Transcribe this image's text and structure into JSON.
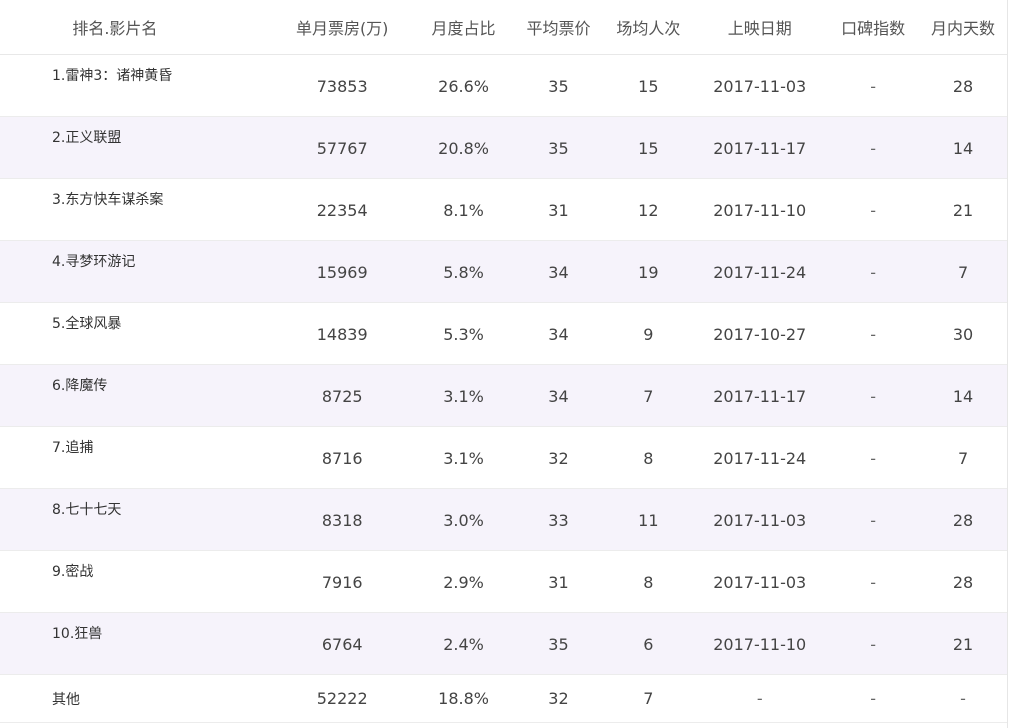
{
  "headers": {
    "name": "排名.影片名",
    "box_office": "单月票房(万)",
    "share": "月度占比",
    "avg_price": "平均票价",
    "avg_attendance": "场均人次",
    "release_date": "上映日期",
    "rating": "口碑指数",
    "days": "月内天数"
  },
  "rows": [
    {
      "name": "1.雷神3：诸神黄昏",
      "box_office": "73853",
      "share": "26.6%",
      "avg_price": "35",
      "avg_attendance": "15",
      "release_date": "2017-11-03",
      "rating": "-",
      "days": "28"
    },
    {
      "name": "2.正义联盟",
      "box_office": "57767",
      "share": "20.8%",
      "avg_price": "35",
      "avg_attendance": "15",
      "release_date": "2017-11-17",
      "rating": "-",
      "days": "14"
    },
    {
      "name": "3.东方快车谋杀案",
      "box_office": "22354",
      "share": "8.1%",
      "avg_price": "31",
      "avg_attendance": "12",
      "release_date": "2017-11-10",
      "rating": "-",
      "days": "21"
    },
    {
      "name": "4.寻梦环游记",
      "box_office": "15969",
      "share": "5.8%",
      "avg_price": "34",
      "avg_attendance": "19",
      "release_date": "2017-11-24",
      "rating": "-",
      "days": "7"
    },
    {
      "name": "5.全球风暴",
      "box_office": "14839",
      "share": "5.3%",
      "avg_price": "34",
      "avg_attendance": "9",
      "release_date": "2017-10-27",
      "rating": "-",
      "days": "30"
    },
    {
      "name": "6.降魔传",
      "box_office": "8725",
      "share": "3.1%",
      "avg_price": "34",
      "avg_attendance": "7",
      "release_date": "2017-11-17",
      "rating": "-",
      "days": "14"
    },
    {
      "name": "7.追捕",
      "box_office": "8716",
      "share": "3.1%",
      "avg_price": "32",
      "avg_attendance": "8",
      "release_date": "2017-11-24",
      "rating": "-",
      "days": "7"
    },
    {
      "name": "8.七十七天",
      "box_office": "8318",
      "share": "3.0%",
      "avg_price": "33",
      "avg_attendance": "11",
      "release_date": "2017-11-03",
      "rating": "-",
      "days": "28"
    },
    {
      "name": "9.密战",
      "box_office": "7916",
      "share": "2.9%",
      "avg_price": "31",
      "avg_attendance": "8",
      "release_date": "2017-11-03",
      "rating": "-",
      "days": "28"
    },
    {
      "name": "10.狂兽",
      "box_office": "6764",
      "share": "2.4%",
      "avg_price": "35",
      "avg_attendance": "6",
      "release_date": "2017-11-10",
      "rating": "-",
      "days": "21"
    },
    {
      "name": "其他",
      "box_office": "52222",
      "share": "18.8%",
      "avg_price": "32",
      "avg_attendance": "7",
      "release_date": "-",
      "rating": "-",
      "days": "-"
    }
  ],
  "colors": {
    "alt_row_bg": "#f6f3fb",
    "border": "#ececec",
    "text": "#444444"
  }
}
